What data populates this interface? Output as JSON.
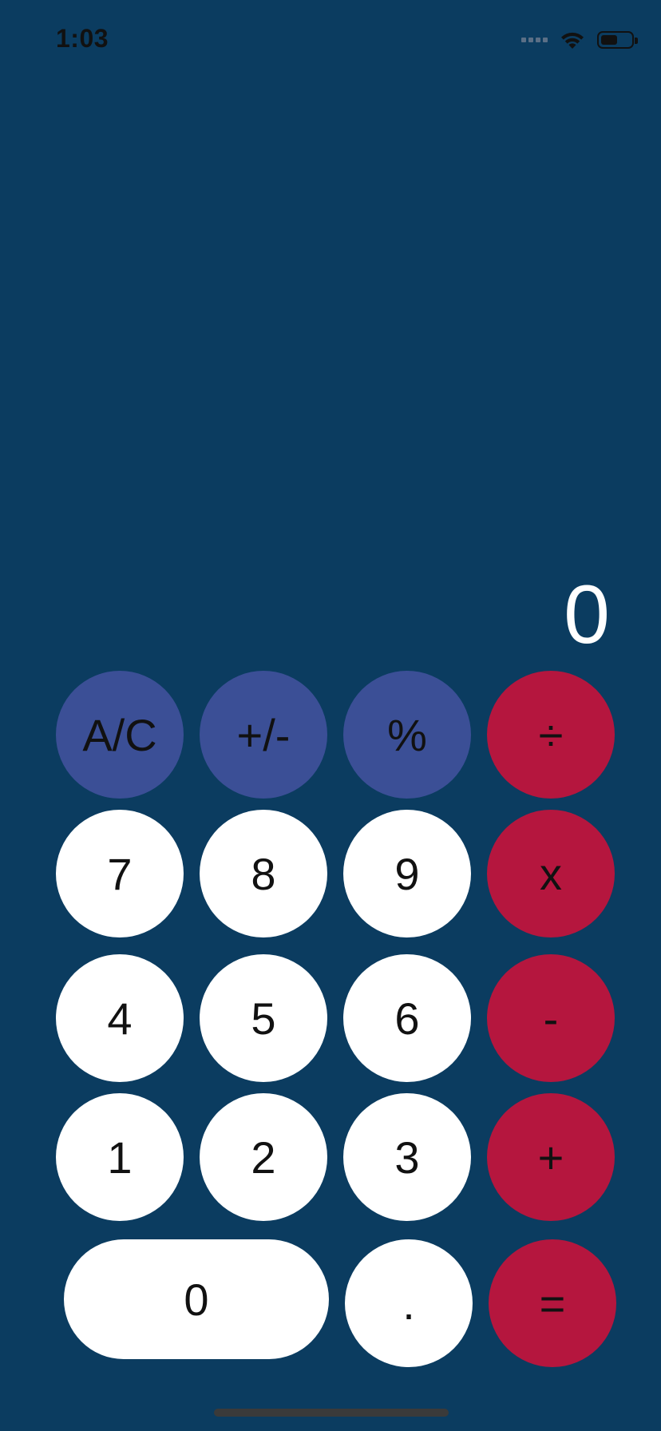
{
  "status_bar": {
    "time": "1:03"
  },
  "display": {
    "value": "0"
  },
  "keys": {
    "ac": "A/C",
    "plus_minus": "+/-",
    "percent": "%",
    "divide": "÷",
    "seven": "7",
    "eight": "8",
    "nine": "9",
    "multiply": "x",
    "four": "4",
    "five": "5",
    "six": "6",
    "minus": "-",
    "one": "1",
    "two": "2",
    "three": "3",
    "plus": "+",
    "zero": "0",
    "decimal": ".",
    "equals": "="
  },
  "colors": {
    "background": "#0b3c60",
    "function_key": "#3b4f96",
    "operator_key": "#b5163e",
    "number_key": "#ffffff",
    "display_text": "#ffffff"
  },
  "icons": {
    "cellular": "cellular-signal-icon",
    "wifi": "wifi-icon",
    "battery": "battery-icon"
  }
}
